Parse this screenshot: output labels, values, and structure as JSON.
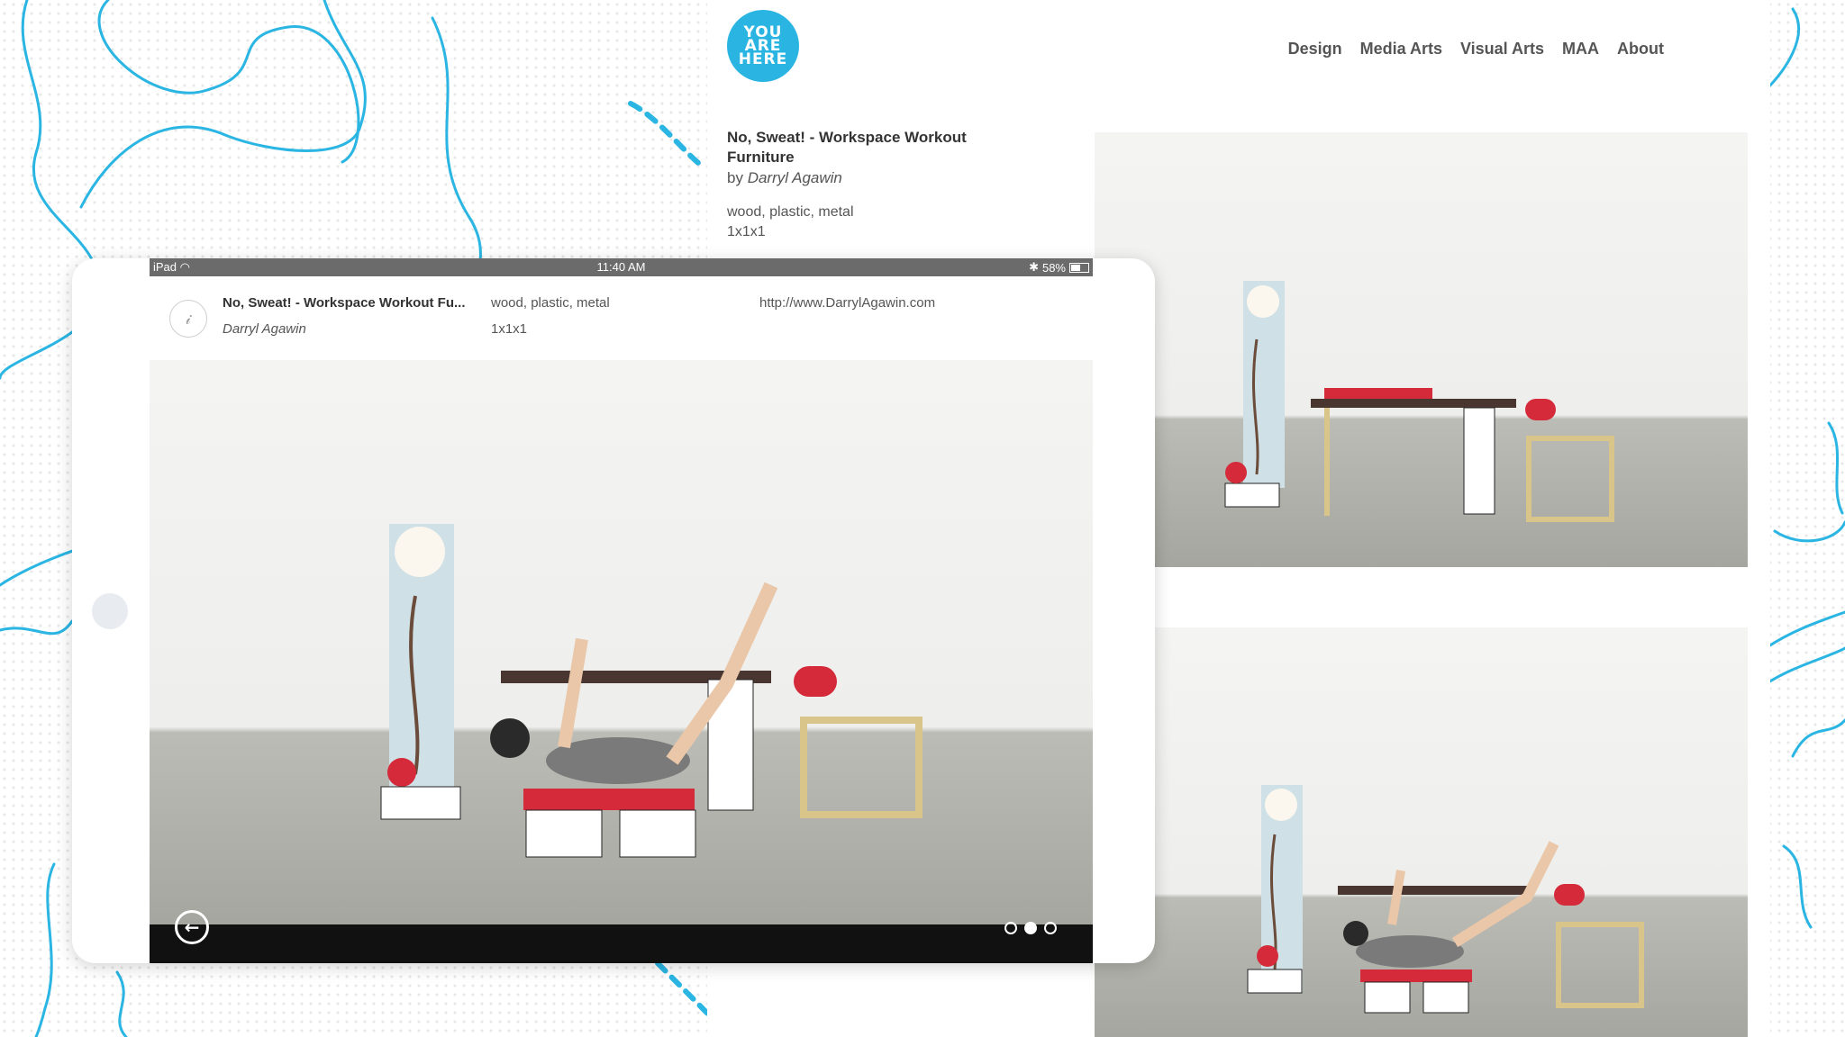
{
  "site": {
    "logo_lines": [
      "YOU",
      "ARE",
      "HERE"
    ],
    "nav": [
      "Design",
      "Media Arts",
      "Visual Arts",
      "MAA",
      "About"
    ],
    "artwork": {
      "title": "No, Sweat! - Workspace Workout Furniture",
      "by_prefix": "by",
      "artist": "Darryl Agawin",
      "material": "wood, plastic, metal",
      "size": "1x1x1"
    }
  },
  "ipad": {
    "status": {
      "device": "iPad",
      "time": "11:40 AM",
      "battery": "58%"
    },
    "info": {
      "title": "No, Sweat! - Workspace Workout Fu...",
      "artist": "Darryl Agawin",
      "material": "wood, plastic, metal",
      "size": "1x1x1",
      "url": "http://www.DarrylAgawin.com"
    },
    "pager": {
      "count": 3,
      "active": 2
    }
  },
  "colors": {
    "accent": "#29b4e2",
    "bar": "#111111",
    "status_bar": "#6b6b6b"
  },
  "icons": [
    "back-arrow-icon",
    "wifi-icon",
    "bluetooth-icon",
    "battery-icon",
    "artwork-icon"
  ]
}
